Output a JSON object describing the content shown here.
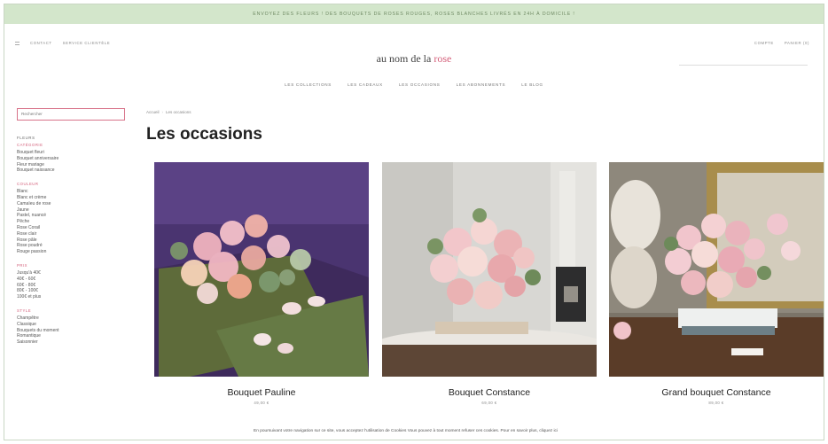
{
  "promo_banner": "Envoyez des fleurs ! Des bouquets de roses rouges, roses blanches livrés en 24h à domicile !",
  "top_nav_left": [
    "Contact",
    "Service clientèle"
  ],
  "top_nav_right": [
    "Compte",
    "Panier (0)"
  ],
  "logo": {
    "part1": "au nom de la ",
    "part2": "rose"
  },
  "main_nav": [
    "Les collections",
    "Les cadeaux",
    "Les occasions",
    "Les abonnements",
    "Le blog"
  ],
  "sidebar": {
    "search_placeholder": "Rechercher",
    "groups": [
      {
        "heading": "Fleurs",
        "sub": "Catégorie",
        "items": [
          "Bouquet fleuri",
          "Bouquet anniversaire",
          "Fleur mariage",
          "Bouquet naissance"
        ]
      },
      {
        "heading": "",
        "sub": "Couleur",
        "items": [
          "Blanc",
          "Blanc et crème",
          "Camaïeu de rose",
          "Jaune",
          "Pastel, nuancé",
          "Pêche",
          "Rose Corail",
          "Rose clair",
          "Rose pâle",
          "Rose poudré",
          "Rouge passion"
        ]
      },
      {
        "heading": "",
        "sub": "Prix",
        "items": [
          "Jusqu'à 40€",
          "40€ - 60€",
          "60€ - 80€",
          "80€ - 100€",
          "100€ et plus"
        ]
      },
      {
        "heading": "",
        "sub": "Style",
        "items": [
          "Champêtre",
          "Classique",
          "Bouquets du moment",
          "Romantique",
          "Saisonnier"
        ]
      }
    ]
  },
  "breadcrumb": [
    "Accueil",
    "Les occasions"
  ],
  "page_title": "Les occasions",
  "products": [
    {
      "name": "Bouquet Pauline",
      "price": "49,00 €"
    },
    {
      "name": "Bouquet Constance",
      "price": "69,00 €"
    },
    {
      "name": "Grand bouquet Constance",
      "price": "89,00 €"
    }
  ],
  "cookie_text": "En poursuivant votre navigation sur ce site, vous acceptez l'utilisation de Cookies Vous pouvez à tout moment refuser ces cookies. Pour en savoir plus, cliquez ici",
  "colors": {
    "accent": "#d4607b",
    "promo_bg": "#d3e6cb"
  }
}
